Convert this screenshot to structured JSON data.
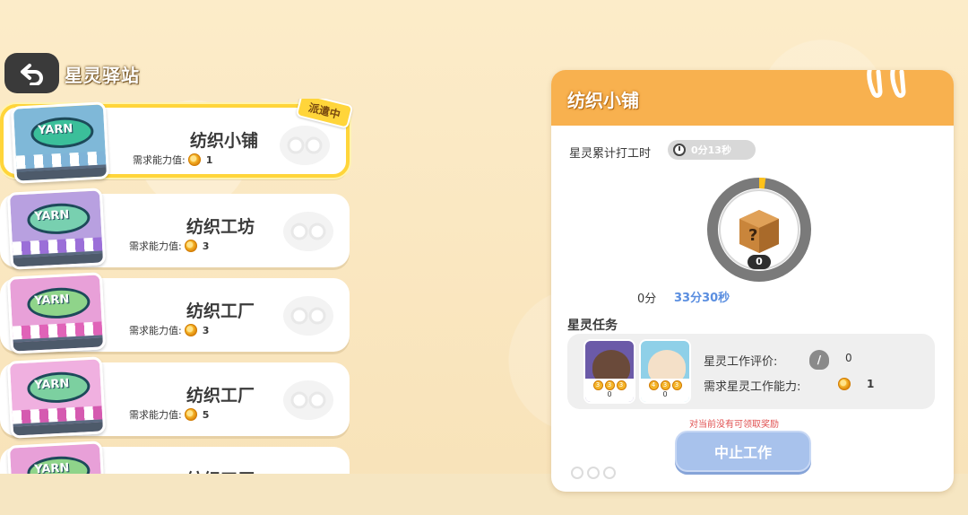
{
  "header": {
    "back_icon": "back-arrow-icon",
    "title": "星灵驿站"
  },
  "stations": [
    {
      "name": "纺织小铺",
      "req_label": "需求能力值:",
      "req_value": "1",
      "badge": "派遣中",
      "selected": true,
      "theme": "blue"
    },
    {
      "name": "纺织工坊",
      "req_label": "需求能力值:",
      "req_value": "3",
      "badge": "",
      "selected": false,
      "theme": "purple"
    },
    {
      "name": "纺织工厂",
      "req_label": "需求能力值:",
      "req_value": "3",
      "badge": "",
      "selected": false,
      "theme": "pink"
    },
    {
      "name": "纺织工厂",
      "req_label": "需求能力值:",
      "req_value": "5",
      "badge": "",
      "selected": false,
      "theme": "pink2"
    },
    {
      "name": "纺织工厂",
      "req_label": "",
      "req_value": "",
      "badge": "",
      "selected": false,
      "theme": "pink"
    }
  ],
  "thumb_sign": "YARN",
  "detail": {
    "title": "纺织小铺",
    "worktime_label": "星灵累计打工时",
    "worktime_value": "0分13秒",
    "chest_count": "0",
    "progress_current": "0分",
    "progress_total": "33分30秒",
    "progress_fraction": 0.0065,
    "tasks_title": "星灵任务",
    "spirits": [
      {
        "name": "sunglasses-spirit",
        "count": "0",
        "coins": [
          "3",
          "3",
          "3"
        ]
      },
      {
        "name": "sheep-spirit",
        "count": "0",
        "coins": [
          "4",
          "3",
          "3"
        ]
      }
    ],
    "eval_label": "星灵工作评价:",
    "eval_icon": "rating-unknown-icon",
    "eval_value": "0",
    "need_label": "需求星灵工作能力:",
    "need_value": "1",
    "reward_note": "对当前没有可领取奖励",
    "stop_label": "中止工作"
  },
  "colors": {
    "header_orange": "#f8b14f",
    "selected_border": "#ffd53a",
    "stop_button": "#a8c2ec",
    "progress_blue": "#5a8ee0",
    "note_red": "#e05050"
  }
}
